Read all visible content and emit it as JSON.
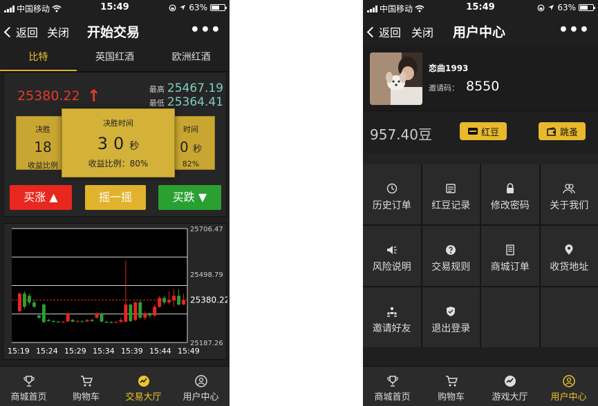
{
  "left": {
    "status": {
      "carrier": "中国移动",
      "time": "15:49",
      "battery": "63%"
    },
    "nav": {
      "back": "返回",
      "close": "关闭",
      "title": "开始交易",
      "more": "•••"
    },
    "tabs": [
      "比特",
      "英国红酒",
      "欧洲红酒"
    ],
    "active_tab": 0,
    "quote": {
      "price": "25380.22",
      "high_label": "最高",
      "high": "25467.19",
      "low_label": "最低",
      "low": "25364.41"
    },
    "cards": {
      "title": "决胜时间",
      "left": {
        "title": "决胜",
        "num": "18",
        "pct": "收益比例"
      },
      "main": {
        "title": "决胜时间",
        "num": "30",
        "unit": "秒",
        "pct": "收益比例：80%"
      },
      "right": {
        "title": "时间",
        "num": "0",
        "unit": "秒",
        "pct": "82%"
      }
    },
    "buttons": {
      "up": "买涨 ▲",
      "shake": "摇一摇",
      "down": "买跌 ▼"
    },
    "bottom_tabs": [
      "商城首页",
      "购物车",
      "交易大厅",
      "用户中心"
    ],
    "active_bottom": 2
  },
  "chart_data": {
    "type": "candlestick",
    "x_ticks": [
      "15:19",
      "15:24",
      "15:29",
      "15:34",
      "15:39",
      "15:44",
      "15:49"
    ],
    "y_ticks": [
      "25706.47",
      "25498.79",
      "25380.22",
      "25187.26"
    ],
    "ylim": [
      25187.26,
      25706.47
    ],
    "current": 25380.22,
    "candles": [
      {
        "o": 25330,
        "c": 25410,
        "h": 25415,
        "l": 25325
      },
      {
        "o": 25410,
        "c": 25350,
        "h": 25420,
        "l": 25340
      },
      {
        "o": 25400,
        "c": 25370,
        "h": 25410,
        "l": 25360
      },
      {
        "o": 25370,
        "c": 25350,
        "h": 25380,
        "l": 25345
      },
      {
        "o": 25310,
        "c": 25300,
        "h": 25320,
        "l": 25295
      },
      {
        "o": 25360,
        "c": 25280,
        "h": 25365,
        "l": 25275
      },
      {
        "o": 25290,
        "c": 25285,
        "h": 25295,
        "l": 25282
      },
      {
        "o": 25285,
        "c": 25283,
        "h": 25290,
        "l": 25280
      },
      {
        "o": 25282,
        "c": 25280,
        "h": 25286,
        "l": 25278
      },
      {
        "o": 25280,
        "c": 25282,
        "h": 25285,
        "l": 25277
      },
      {
        "o": 25283,
        "c": 25320,
        "h": 25325,
        "l": 25280
      },
      {
        "o": 25290,
        "c": 25282,
        "h": 25294,
        "l": 25280
      },
      {
        "o": 25282,
        "c": 25284,
        "h": 25288,
        "l": 25280
      },
      {
        "o": 25284,
        "c": 25283,
        "h": 25288,
        "l": 25280
      },
      {
        "o": 25283,
        "c": 25290,
        "h": 25294,
        "l": 25280
      },
      {
        "o": 25290,
        "c": 25285,
        "h": 25295,
        "l": 25282
      },
      {
        "o": 25300,
        "c": 25320,
        "h": 25325,
        "l": 25295
      },
      {
        "o": 25320,
        "c": 25282,
        "h": 25325,
        "l": 25280
      },
      {
        "o": 25282,
        "c": 25280,
        "h": 25286,
        "l": 25276
      },
      {
        "o": 25280,
        "c": 25279,
        "h": 25284,
        "l": 25276
      },
      {
        "o": 25279,
        "c": 25281,
        "h": 25284,
        "l": 25276
      },
      {
        "o": 25281,
        "c": 25290,
        "h": 25300,
        "l": 25278
      },
      {
        "o": 25282,
        "c": 25360,
        "h": 25560,
        "l": 25280
      },
      {
        "o": 25360,
        "c": 25285,
        "h": 25365,
        "l": 25280
      },
      {
        "o": 25290,
        "c": 25370,
        "h": 25375,
        "l": 25285
      },
      {
        "o": 25370,
        "c": 25300,
        "h": 25380,
        "l": 25295
      },
      {
        "o": 25300,
        "c": 25320,
        "h": 25330,
        "l": 25290
      },
      {
        "o": 25320,
        "c": 25310,
        "h": 25325,
        "l": 25300
      },
      {
        "o": 25310,
        "c": 25350,
        "h": 25360,
        "l": 25305
      },
      {
        "o": 25350,
        "c": 25390,
        "h": 25400,
        "l": 25345
      },
      {
        "o": 25390,
        "c": 25370,
        "h": 25400,
        "l": 25360
      },
      {
        "o": 25370,
        "c": 25380,
        "h": 25420,
        "l": 25360
      },
      {
        "o": 25380,
        "c": 25400,
        "h": 25430,
        "l": 25350
      },
      {
        "o": 25400,
        "c": 25360,
        "h": 25430,
        "l": 25355
      },
      {
        "o": 25360,
        "c": 25380,
        "h": 25410,
        "l": 25358
      }
    ]
  },
  "right": {
    "status": {
      "carrier": "中国移动",
      "time": "15:49",
      "battery": "63%"
    },
    "nav": {
      "back": "返回",
      "close": "关闭",
      "title": "用户中心",
      "more": "•••"
    },
    "profile": {
      "name": "恋曲1993",
      "invite_label": "邀请码：",
      "invite_code": "8550"
    },
    "balance": "957.40豆",
    "buttons": {
      "hongdou": "红豆",
      "tiaodan": "跳蚤"
    },
    "menu": [
      {
        "label": "历史订单",
        "icon": "history-icon"
      },
      {
        "label": "红豆记录",
        "icon": "record-icon"
      },
      {
        "label": "修改密码",
        "icon": "lock-icon"
      },
      {
        "label": "关于我们",
        "icon": "people-icon"
      },
      {
        "label": "风险说明",
        "icon": "speaker-icon"
      },
      {
        "label": "交易规则",
        "icon": "question-icon"
      },
      {
        "label": "商城订单",
        "icon": "book-icon"
      },
      {
        "label": "收货地址",
        "icon": "location-icon"
      },
      {
        "label": "邀请好友",
        "icon": "invite-icon"
      },
      {
        "label": "退出登录",
        "icon": "shield-icon"
      }
    ],
    "bottom_tabs": [
      "商城首页",
      "购物车",
      "游戏大厅",
      "用户中心"
    ],
    "active_bottom": 3
  },
  "colors": {
    "accent": "#f0c52a",
    "red": "#e8271f",
    "green": "#2aa032",
    "bg": "#1f1f1f"
  }
}
